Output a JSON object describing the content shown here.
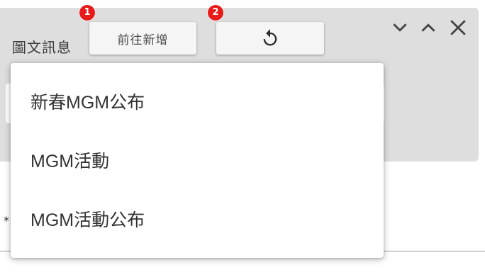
{
  "panel": {
    "label": "圖文訊息",
    "add_button_label": "前往新增",
    "badges": [
      "1",
      "2"
    ]
  },
  "window_controls": {
    "icons": [
      "chevron-down-icon",
      "chevron-up-icon",
      "close-icon"
    ]
  },
  "form": {
    "required_marker": "*"
  },
  "dropdown": {
    "options": [
      {
        "label": "新春MGM公布"
      },
      {
        "label": "MGM活動"
      },
      {
        "label": "MGM活動公布"
      }
    ]
  },
  "colors": {
    "panel_bg": "#dedede",
    "badge": "#e81a1a",
    "button_bg": "#f5f5f5",
    "text": "#333333"
  }
}
